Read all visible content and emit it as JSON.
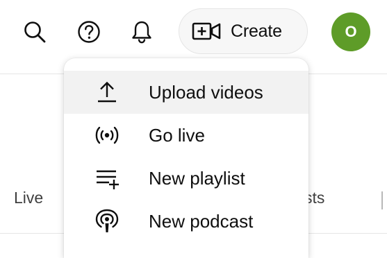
{
  "toolbar": {
    "create_label": "Create",
    "avatar_initial": "O",
    "icons": [
      "search-icon",
      "help-icon",
      "bell-icon",
      "video-add-icon"
    ]
  },
  "tabs": {
    "left": "Live",
    "partial": "sts"
  },
  "menu": {
    "items": [
      {
        "label": "Upload videos",
        "icon": "upload-icon",
        "highlighted": true
      },
      {
        "label": "Go live",
        "icon": "live-broadcast-icon",
        "highlighted": false
      },
      {
        "label": "New playlist",
        "icon": "playlist-add-icon",
        "highlighted": false
      },
      {
        "label": "New podcast",
        "icon": "podcast-icon",
        "highlighted": false
      }
    ]
  },
  "colors": {
    "avatar": "#5e9c28",
    "highlight": "#f2f2f2",
    "text": "#0f0f0f"
  }
}
